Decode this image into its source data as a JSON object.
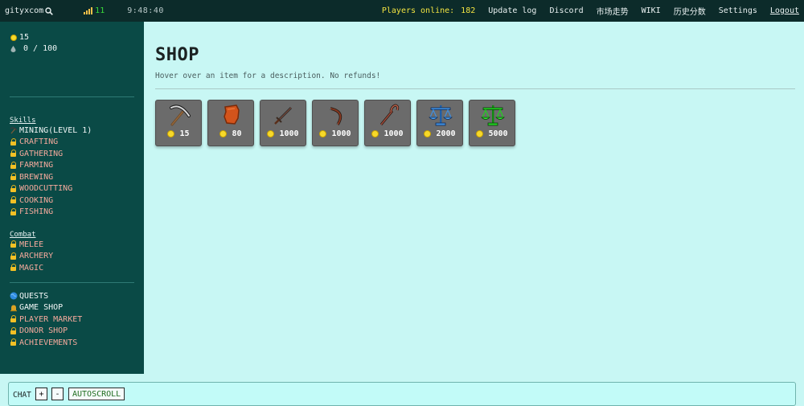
{
  "topbar": {
    "username": "gityxcom",
    "ping": "11",
    "clock": "9:48:40",
    "players_online_label": "Players online:",
    "players_online_count": "182",
    "links": [
      "Update log",
      "Discord",
      "市场走势",
      "WIKI",
      "历史分数",
      "Settings",
      "Logout"
    ]
  },
  "sidebar": {
    "coins": "15",
    "water": "0 / 100",
    "skills_title": "Skills",
    "skills": [
      {
        "label": "MINING(LEVEL 1)",
        "icon": "pickaxe-icon",
        "locked": false
      },
      {
        "label": "CRAFTING",
        "icon": "lock-icon",
        "locked": true
      },
      {
        "label": "GATHERING",
        "icon": "lock-icon",
        "locked": true
      },
      {
        "label": "FARMING",
        "icon": "lock-icon",
        "locked": true
      },
      {
        "label": "BREWING",
        "icon": "lock-icon",
        "locked": true
      },
      {
        "label": "WOODCUTTING",
        "icon": "lock-icon",
        "locked": true
      },
      {
        "label": "COOKING",
        "icon": "lock-icon",
        "locked": true
      },
      {
        "label": "FISHING",
        "icon": "lock-icon",
        "locked": true
      }
    ],
    "combat_title": "Combat",
    "combat": [
      {
        "label": "MELEE",
        "icon": "lock-icon",
        "locked": true
      },
      {
        "label": "ARCHERY",
        "icon": "lock-icon",
        "locked": true
      },
      {
        "label": "MAGIC",
        "icon": "lock-icon",
        "locked": true
      }
    ],
    "other": [
      {
        "label": "QUESTS",
        "icon": "globe-icon",
        "locked": false
      },
      {
        "label": "GAME SHOP",
        "icon": "bell-icon",
        "locked": false
      },
      {
        "label": "PLAYER MARKET",
        "icon": "lock-icon",
        "locked": true
      },
      {
        "label": "DONOR SHOP",
        "icon": "lock-icon",
        "locked": true
      },
      {
        "label": "ACHIEVEMENTS",
        "icon": "lock-icon",
        "locked": true
      }
    ]
  },
  "main": {
    "title": "SHOP",
    "subtitle": "Hover over an item for a description. No refunds!",
    "items": [
      {
        "icon": "pickaxe-icon",
        "price": "15"
      },
      {
        "icon": "leather-icon",
        "price": "80"
      },
      {
        "icon": "sword-icon",
        "price": "1000"
      },
      {
        "icon": "bow-icon",
        "price": "1000"
      },
      {
        "icon": "staff-icon",
        "price": "1000"
      },
      {
        "icon": "blue-scales-icon",
        "price": "2000"
      },
      {
        "icon": "green-scales-icon",
        "price": "5000"
      }
    ]
  },
  "chat": {
    "label": "CHAT",
    "plus": "+",
    "minus": "-",
    "autoscroll": "AUTOSCROLL"
  },
  "colors": {
    "topbar_bg": "#0c2b2a",
    "sidebar_bg": "#0a4a46",
    "main_bg": "#c8f7f4",
    "players_online": "#f2e341",
    "locked_text": "#f4a99c",
    "coin": "#f7d92a"
  }
}
